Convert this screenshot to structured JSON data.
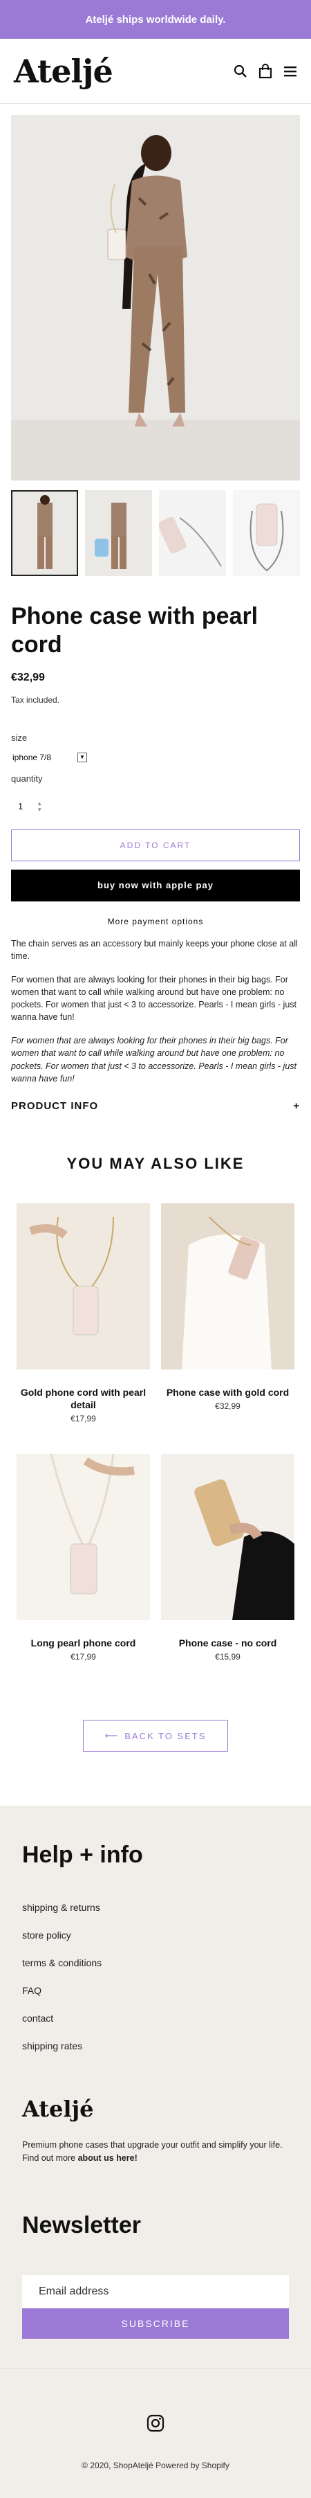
{
  "announcement": "Ateljé ships worldwide daily.",
  "header": {
    "logo": "Ateljé",
    "icons": [
      "search-icon",
      "bag-icon",
      "menu-icon"
    ]
  },
  "product": {
    "title": "Phone case with pearl cord",
    "price": "€32,99",
    "tax": "Tax included.",
    "size_label": "size",
    "size_value": "iphone 7/8",
    "quantity_label": "quantity",
    "quantity_value": "1",
    "add_to_cart": "ADD TO CART",
    "buy_now": "buy now with apple pay",
    "more_payment": "More payment options",
    "description": [
      "The chain serves as an accessory but mainly keeps your phone close at all time.",
      "For women that are always looking for their phones in their big bags. For women that want to call while walking around but have one problem: no pockets. For women that just < 3 to accessorize. Pearls - I mean girls - just wanna have fun!",
      "For women that are always looking for their phones in their big bags. For women that want to call while walking around but have one problem: no pockets. For women that just < 3 to accessorize. Pearls - I mean girls - just wanna have fun!"
    ],
    "product_info": "PRODUCT INFO",
    "product_info_toggle": "+"
  },
  "related": {
    "title": "YOU MAY ALSO LIKE",
    "items": [
      {
        "name": "Gold phone cord with pearl detail",
        "price": "€17,99"
      },
      {
        "name": "Phone case with gold cord",
        "price": "€32,99"
      },
      {
        "name": "Long pearl phone cord",
        "price": "€17,99"
      },
      {
        "name": "Phone case - no cord",
        "price": "€15,99"
      }
    ],
    "back_button": "BACK TO SETS"
  },
  "footer": {
    "help_title": "Help + info",
    "links": [
      "shipping & returns",
      "store policy",
      "terms & conditions",
      "FAQ",
      "contact",
      "shipping rates"
    ],
    "brand": "Ateljé",
    "brand_text": "Premium phone cases that upgrade your outfit and simplify your life. Find out more",
    "brand_link": "about us here!",
    "newsletter_title": "Newsletter",
    "email_placeholder": "Email address",
    "subscribe": "SUBSCRIBE",
    "copyright": "© 2020, ShopAteljé Powered by Shopify"
  },
  "colors": {
    "accent": "#9b7ad6",
    "black": "#000000",
    "footer_bg": "#f1eeea"
  }
}
